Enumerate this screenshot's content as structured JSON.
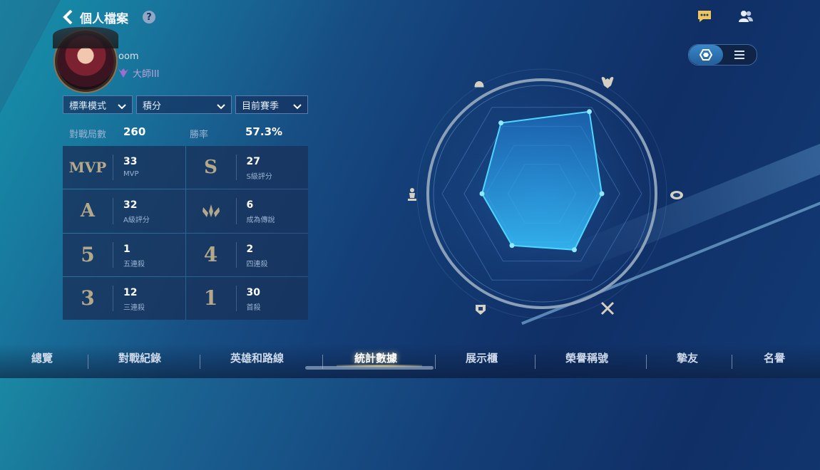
{
  "header": {
    "title": "個人檔案",
    "help": "?"
  },
  "profile": {
    "username": "oom",
    "rank": "大師III"
  },
  "filters": {
    "mode": "標準模式",
    "type": "積分",
    "season": "目前賽季"
  },
  "summary": {
    "matches_label": "對戰局數",
    "matches_value": "260",
    "winrate_label": "勝率",
    "winrate_value": "57.3%"
  },
  "stats": [
    {
      "icon": "MVP",
      "value": "33",
      "label": "MVP"
    },
    {
      "icon": "S",
      "value": "27",
      "label": "S級評分"
    },
    {
      "icon": "A",
      "value": "32",
      "label": "A級評分"
    },
    {
      "icon": "legend-icon",
      "value": "6",
      "label": "成為傳說"
    },
    {
      "icon": "5",
      "value": "1",
      "label": "五連殺"
    },
    {
      "icon": "4",
      "value": "2",
      "label": "四連殺"
    },
    {
      "icon": "3",
      "value": "12",
      "label": "三連殺"
    },
    {
      "icon": "1",
      "value": "30",
      "label": "首殺"
    }
  ],
  "radar_values": [
    0.82,
    0.95,
    0.6,
    0.65,
    0.6,
    0.6
  ],
  "nav": [
    "總覽",
    "對戰紀錄",
    "英雄和路線",
    "統計數據",
    "展示櫃",
    "榮譽稱號",
    "摯友",
    "名譽"
  ],
  "active_nav": "統計數據",
  "colors": {
    "accent": "#2ec7ff",
    "gold": "#b4a88a"
  }
}
